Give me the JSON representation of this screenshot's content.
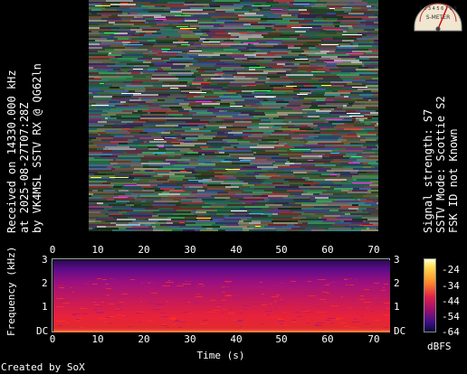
{
  "left_caption": {
    "line1": "Received on  14330.000 kHz",
    "line2": "at 2025-08-27T07:28Z",
    "line3": "by VK4MSL SSTV RX @ QG62ln"
  },
  "right_caption": {
    "line1": "Signal strength: S7",
    "line2": "SSTV Mode: Scottie S2",
    "line3": "FSK ID not Known"
  },
  "meter": {
    "scale_text": "1 2 3 4 5 6 7 8 9",
    "label": "S-METER"
  },
  "spectrogram": {
    "time_ticks": [
      "0",
      "10",
      "20",
      "30",
      "40",
      "50",
      "60",
      "70"
    ],
    "freq_ticks_left": [
      "3",
      "2",
      "1",
      "DC"
    ],
    "freq_ticks_right": [
      "3",
      "2",
      "1",
      "DC"
    ],
    "xlabel": "Time (s)",
    "ylabel": "Frequency (kHz)"
  },
  "colorbar": {
    "ticks": [
      "-24",
      "-34",
      "-44",
      "-54",
      "-64"
    ],
    "unit": "dBFS"
  },
  "footer": "Created by SoX"
}
